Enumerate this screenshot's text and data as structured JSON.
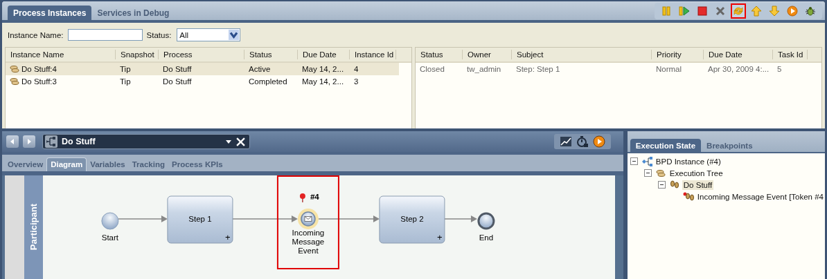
{
  "top_panel": {
    "tabs": [
      {
        "label": "Process Instances",
        "selected": true
      },
      {
        "label": "Services in Debug",
        "selected": false
      }
    ],
    "toolbar": [
      {
        "kind": "pause",
        "highlighted": false
      },
      {
        "kind": "step",
        "highlighted": false
      },
      {
        "kind": "stop",
        "highlighted": false
      },
      {
        "kind": "delete",
        "highlighted": false
      },
      {
        "kind": "refresh",
        "highlighted": true
      },
      {
        "kind": "up",
        "highlighted": false
      },
      {
        "kind": "down",
        "highlighted": false
      },
      {
        "kind": "run",
        "highlighted": false
      },
      {
        "kind": "debug",
        "highlighted": false
      }
    ],
    "filter": {
      "name_label": "Instance Name:",
      "status_label": "Status:",
      "status_value": "All"
    },
    "instances": {
      "columns": [
        "Instance Name",
        "Snapshot",
        "Process",
        "Status",
        "Due Date",
        "Instance Id"
      ],
      "rows": [
        {
          "cells": [
            "Do Stuff:4",
            "Tip",
            "Do Stuff",
            "Active",
            "May 14, 2...",
            "4"
          ],
          "selected": true
        },
        {
          "cells": [
            "Do Stuff:3",
            "Tip",
            "Do Stuff",
            "Completed",
            "May 14, 2...",
            "3"
          ],
          "selected": false
        }
      ]
    },
    "tasks": {
      "columns": [
        "Status",
        "Owner",
        "Subject",
        "Priority",
        "Due Date",
        "Task Id"
      ],
      "rows": [
        {
          "cells": [
            "Closed",
            "tw_admin",
            "Step: Step 1",
            "Normal",
            "Apr 30, 2009 4:...",
            "5"
          ]
        }
      ]
    }
  },
  "editor": {
    "process": "Do Stuff",
    "tabs": [
      {
        "label": "Overview",
        "selected": false
      },
      {
        "label": "Diagram",
        "selected": true
      },
      {
        "label": "Variables",
        "selected": false
      },
      {
        "label": "Tracking",
        "selected": false
      },
      {
        "label": "Process KPIs",
        "selected": false
      }
    ],
    "lane": "Participant",
    "nodes": [
      {
        "kind": "start",
        "label": "Start",
        "highlighted": false
      },
      {
        "kind": "task",
        "label": "Step 1",
        "marker": "+",
        "highlighted": false
      },
      {
        "kind": "message",
        "label": "Incoming Message Event",
        "token": "#4",
        "highlighted": true
      },
      {
        "kind": "task",
        "label": "Step 2",
        "marker": "+",
        "highlighted": false
      },
      {
        "kind": "end",
        "label": "End",
        "highlighted": false
      }
    ]
  },
  "side_panel": {
    "tabs": [
      {
        "label": "Execution State",
        "selected": true
      },
      {
        "label": "Breakpoints",
        "selected": false
      }
    ],
    "tree": [
      {
        "kind": "bpd",
        "label": "BPD Instance (#4)",
        "expanded": true,
        "selected": false,
        "children": [
          {
            "kind": "tree",
            "label": "Execution Tree",
            "expanded": true,
            "selected": false,
            "children": [
              {
                "kind": "steps",
                "label": "Do Stuff",
                "expanded": true,
                "selected": true,
                "children": [
                  {
                    "kind": "token",
                    "label": "Incoming Message Event [Token #4",
                    "selected": false
                  }
                ]
              }
            ]
          }
        ]
      }
    ]
  }
}
